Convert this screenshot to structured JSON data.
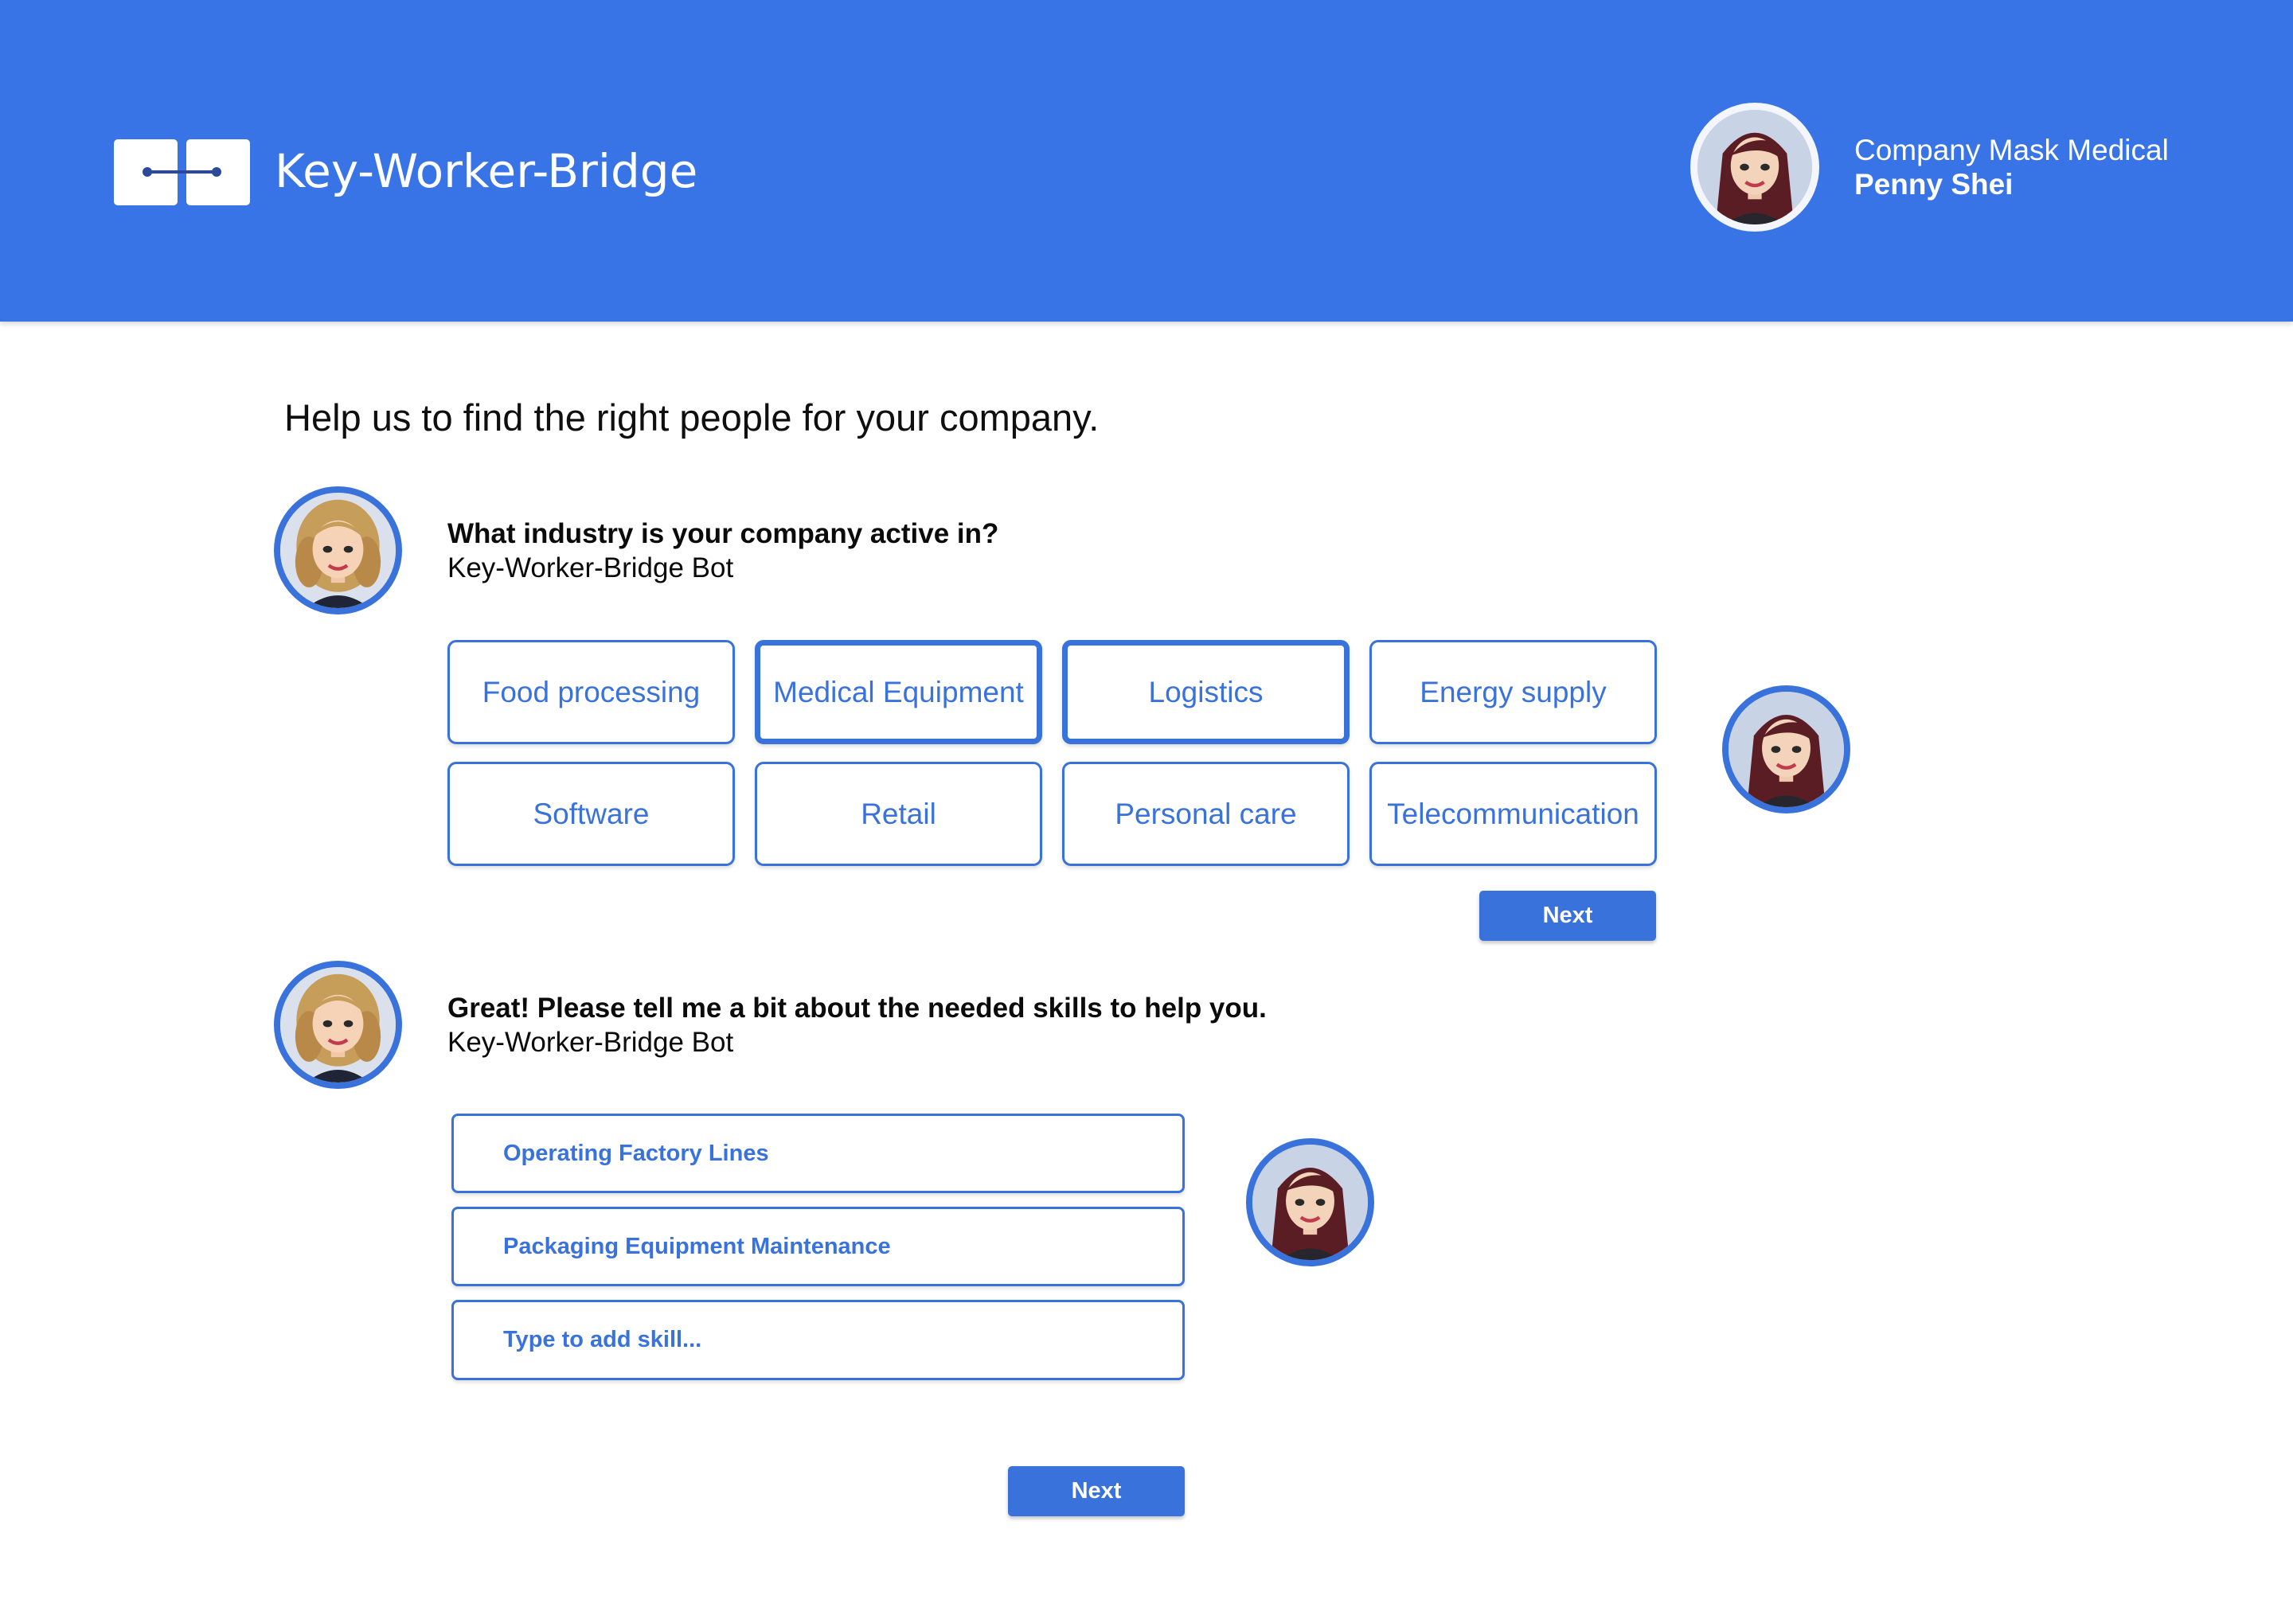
{
  "header": {
    "app_title": "Key-Worker-Bridge",
    "company": "Company Mask Medical",
    "user_name": "Penny Shei"
  },
  "page": {
    "heading": "Help us to find the right people for your company."
  },
  "question1": {
    "title": "What industry is your company active in?",
    "sender": "Key-Worker-Bridge Bot",
    "options": [
      {
        "label": "Food processing",
        "selected": false
      },
      {
        "label": "Medical Equipment",
        "selected": true
      },
      {
        "label": "Logistics",
        "selected": true
      },
      {
        "label": "Energy supply",
        "selected": false
      },
      {
        "label": "Software",
        "selected": false
      },
      {
        "label": "Retail",
        "selected": false
      },
      {
        "label": "Personal care",
        "selected": false
      },
      {
        "label": "Telecommunication",
        "selected": false
      }
    ],
    "next_label": "Next"
  },
  "question2": {
    "title": "Great! Please tell me a bit about the needed skills to help you.",
    "sender": "Key-Worker-Bridge Bot",
    "skills": [
      "Operating Factory Lines",
      "Packaging Equipment Maintenance"
    ],
    "input_placeholder": "Type to add skill...",
    "next_label": "Next"
  },
  "icons": {
    "logo": "bridge-logo-icon",
    "user_avatar": "user-avatar",
    "bot_avatar": "bot-avatar"
  },
  "colors": {
    "brand_blue": "#3874e5",
    "accent": "#3a72dc",
    "white": "#ffffff"
  }
}
